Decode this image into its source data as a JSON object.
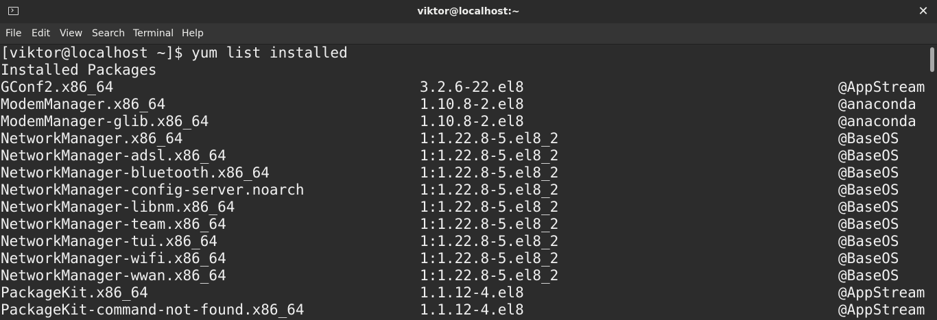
{
  "window": {
    "title": "viktor@localhost:~",
    "icon": "terminal-icon",
    "close_glyph": "✕"
  },
  "menu": [
    {
      "label": "File"
    },
    {
      "label": "Edit"
    },
    {
      "label": "View"
    },
    {
      "label": "Search"
    },
    {
      "label": "Terminal"
    },
    {
      "label": "Help"
    }
  ],
  "terminal": {
    "prompt": "[viktor@localhost ~]$ yum list installed",
    "header": "Installed Packages",
    "packages": [
      {
        "name": "GConf2.x86_64",
        "version": "3.2.6-22.el8",
        "repo": "@AppStream"
      },
      {
        "name": "ModemManager.x86_64",
        "version": "1.10.8-2.el8",
        "repo": "@anaconda"
      },
      {
        "name": "ModemManager-glib.x86_64",
        "version": "1.10.8-2.el8",
        "repo": "@anaconda"
      },
      {
        "name": "NetworkManager.x86_64",
        "version": "1:1.22.8-5.el8_2",
        "repo": "@BaseOS"
      },
      {
        "name": "NetworkManager-adsl.x86_64",
        "version": "1:1.22.8-5.el8_2",
        "repo": "@BaseOS"
      },
      {
        "name": "NetworkManager-bluetooth.x86_64",
        "version": "1:1.22.8-5.el8_2",
        "repo": "@BaseOS"
      },
      {
        "name": "NetworkManager-config-server.noarch",
        "version": "1:1.22.8-5.el8_2",
        "repo": "@BaseOS"
      },
      {
        "name": "NetworkManager-libnm.x86_64",
        "version": "1:1.22.8-5.el8_2",
        "repo": "@BaseOS"
      },
      {
        "name": "NetworkManager-team.x86_64",
        "version": "1:1.22.8-5.el8_2",
        "repo": "@BaseOS"
      },
      {
        "name": "NetworkManager-tui.x86_64",
        "version": "1:1.22.8-5.el8_2",
        "repo": "@BaseOS"
      },
      {
        "name": "NetworkManager-wifi.x86_64",
        "version": "1:1.22.8-5.el8_2",
        "repo": "@BaseOS"
      },
      {
        "name": "NetworkManager-wwan.x86_64",
        "version": "1:1.22.8-5.el8_2",
        "repo": "@BaseOS"
      },
      {
        "name": "PackageKit.x86_64",
        "version": "1.1.12-4.el8",
        "repo": "@AppStream"
      },
      {
        "name": "PackageKit-command-not-found.x86_64",
        "version": "1.1.12-4.el8",
        "repo": "@AppStream"
      }
    ]
  },
  "colors": {
    "terminal_bg": "#2c2c2c",
    "terminal_fg": "#f0f0f0",
    "titlebar_bg": "#2b2b2b"
  }
}
